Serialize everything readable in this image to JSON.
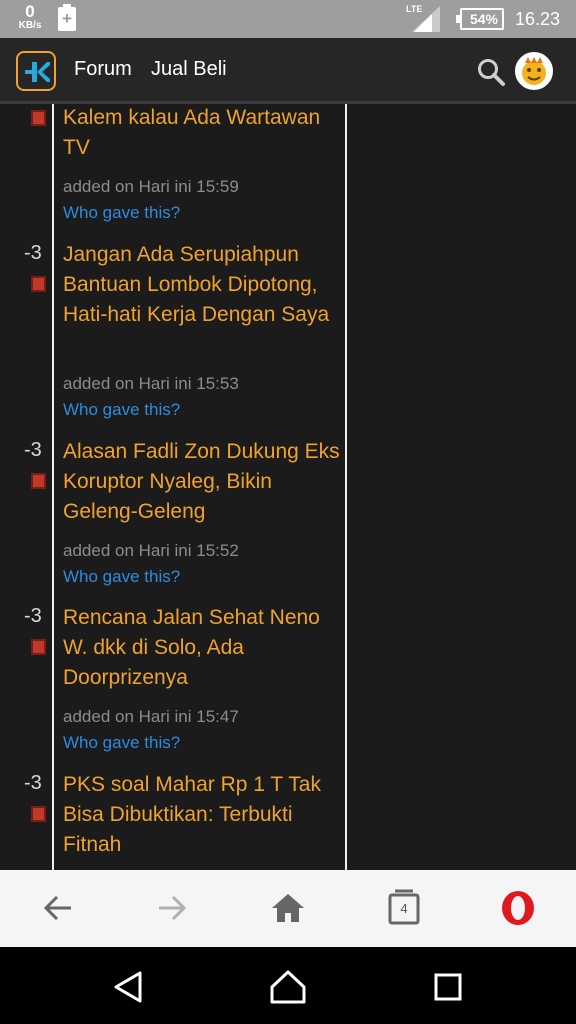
{
  "status_bar": {
    "net_speed_value": "0",
    "net_speed_unit": "KB/s",
    "network_type": "LTE",
    "battery": "54%",
    "time": "16.23"
  },
  "header": {
    "nav_forum": "Forum",
    "nav_jual_beli": "Jual Beli",
    "accent": "#f0a22e"
  },
  "entries": [
    {
      "score": "",
      "title": "Kalem kalau Ada Wartawan TV",
      "added": "added on Hari ini 15:59",
      "who": "Who gave this?"
    },
    {
      "score": "-3",
      "title": "Jangan Ada Serupiahpun Bantuan Lombok Dipotong, Hati-hati Kerja Dengan Saya",
      "added": "added on Hari ini 15:53",
      "who": "Who gave this?"
    },
    {
      "score": "-3",
      "title": "Alasan Fadli Zon Dukung Eks Koruptor Nyaleg, Bikin Geleng-Geleng",
      "added": "added on Hari ini 15:52",
      "who": "Who gave this?"
    },
    {
      "score": "-3",
      "title": "Rencana Jalan Sehat Neno W. dkk di Solo, Ada Doorprizenya",
      "added": "added on Hari ini 15:47",
      "who": "Who gave this?"
    },
    {
      "score": "-3",
      "title": "PKS soal Mahar Rp 1 T Tak Bisa Dibuktikan: Terbukti Fitnah",
      "added": "",
      "who": ""
    }
  ],
  "browser_bar": {
    "tab_count": "4",
    "icons": [
      "back-arrow-icon",
      "forward-arrow-icon",
      "home-icon",
      "tabs-icon",
      "opera-icon"
    ]
  },
  "system_nav": {
    "icons": [
      "back-triangle-icon",
      "home-circle-icon",
      "recents-square-icon"
    ]
  }
}
